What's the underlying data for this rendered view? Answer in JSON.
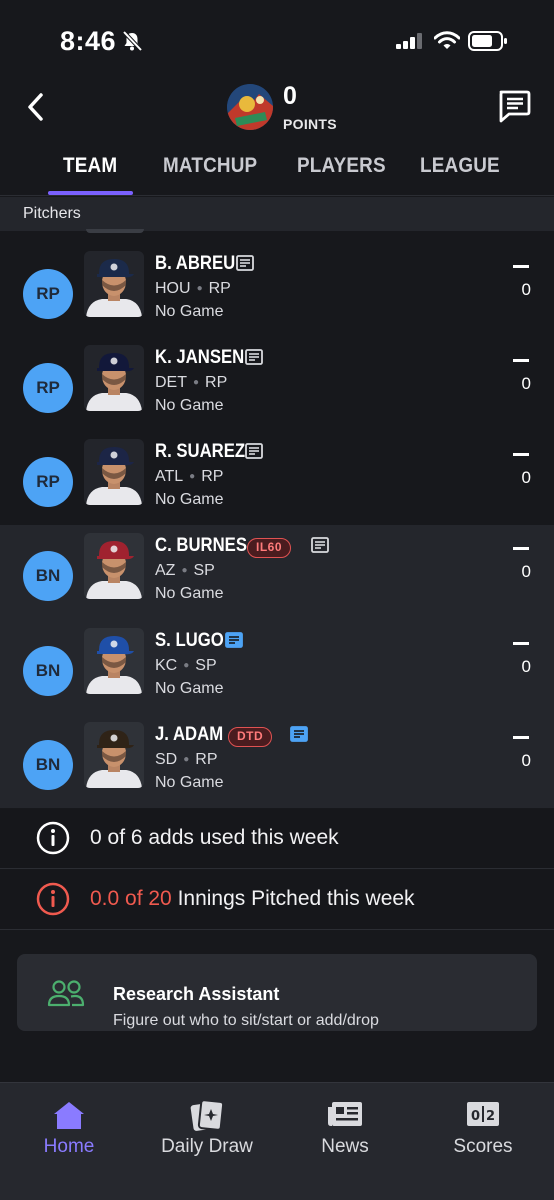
{
  "status_bar": {
    "time": "8:46"
  },
  "header": {
    "points_value": "0",
    "points_label": "POINTS"
  },
  "tabs": [
    {
      "label": "TEAM",
      "active": true
    },
    {
      "label": "MATCHUP",
      "active": false
    },
    {
      "label": "PLAYERS",
      "active": false
    },
    {
      "label": "LEAGUE",
      "active": false
    }
  ],
  "section": {
    "title": "Pitchers"
  },
  "players": [
    {
      "pos": "RP",
      "name": "B. ABREU",
      "team": "HOU",
      "role": "RP",
      "game": "No Game",
      "proj": "—",
      "score": "0",
      "tag": "",
      "note_active": false,
      "bench": false,
      "cap_color": "#1b2a4a"
    },
    {
      "pos": "RP",
      "name": "K. JANSEN",
      "team": "DET",
      "role": "RP",
      "game": "No Game",
      "proj": "—",
      "score": "0",
      "tag": "",
      "note_active": false,
      "bench": false,
      "cap_color": "#12183a"
    },
    {
      "pos": "RP",
      "name": "R. SUAREZ",
      "team": "ATL",
      "role": "RP",
      "game": "No Game",
      "proj": "—",
      "score": "0",
      "tag": "",
      "note_active": false,
      "bench": false,
      "cap_color": "#1c2546"
    },
    {
      "pos": "BN",
      "name": "C. BURNES",
      "team": "AZ",
      "role": "SP",
      "game": "No Game",
      "proj": "—",
      "score": "0",
      "tag": "IL60",
      "note_active": false,
      "bench": true,
      "cap_color": "#a0222f"
    },
    {
      "pos": "BN",
      "name": "S. LUGO",
      "team": "KC",
      "role": "SP",
      "game": "No Game",
      "proj": "—",
      "score": "0",
      "tag": "",
      "note_active": true,
      "bench": true,
      "cap_color": "#1f4fa8"
    },
    {
      "pos": "BN",
      "name": "J. ADAM",
      "team": "SD",
      "role": "RP",
      "game": "No Game",
      "proj": "—",
      "score": "0",
      "tag": "DTD",
      "note_active": true,
      "bench": true,
      "cap_color": "#2f2317"
    }
  ],
  "adds": {
    "text": "0 of 6 adds used this week"
  },
  "innings": {
    "highlight": "0.0 of 20",
    "rest": "Innings Pitched this week"
  },
  "research": {
    "title": "Research Assistant",
    "subtitle": "Figure out who to sit/start or add/drop"
  },
  "nav": [
    {
      "label": "Home",
      "icon": "home-icon",
      "active": true
    },
    {
      "label": "Daily Draw",
      "icon": "daily-draw-icon",
      "active": false
    },
    {
      "label": "News",
      "icon": "news-icon",
      "active": false
    },
    {
      "label": "Scores",
      "icon": "scores-icon",
      "active": false
    }
  ],
  "colors": {
    "accent": "#8a7bff",
    "badge": "#4da3f5",
    "alert": "#f05a4f",
    "research_icon": "#4caf6e"
  }
}
